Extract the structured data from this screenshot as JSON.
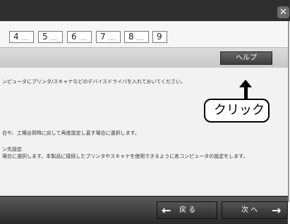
{
  "titlebar": {
    "close_glyph": "✕"
  },
  "steps": [
    {
      "num": "4",
      "dots": "....."
    },
    {
      "num": "5",
      "dots": "....."
    },
    {
      "num": "6",
      "dots": "....."
    },
    {
      "num": "7",
      "dots": "....."
    },
    {
      "num": "8",
      "dots": "....."
    },
    {
      "num": "9",
      "dots": ""
    }
  ],
  "help": {
    "label": "ヘルプ"
  },
  "content": {
    "lines": [
      "ンピュータにプリンタ/スキャナなどのデバイスドライバを入れておいてください。",
      "合や、工場出荷時に戻して再度設定し直す場合に選択します。",
      "ン先設定",
      "場合に選択します。本製品に接続したプリンタやスキャナを使用できるように各コンピュータの設定をします。"
    ]
  },
  "callout": {
    "label": "クリック"
  },
  "footer": {
    "back_label": "戻 る",
    "next_label": "次 へ",
    "back_icon": "←",
    "next_icon": "→"
  }
}
